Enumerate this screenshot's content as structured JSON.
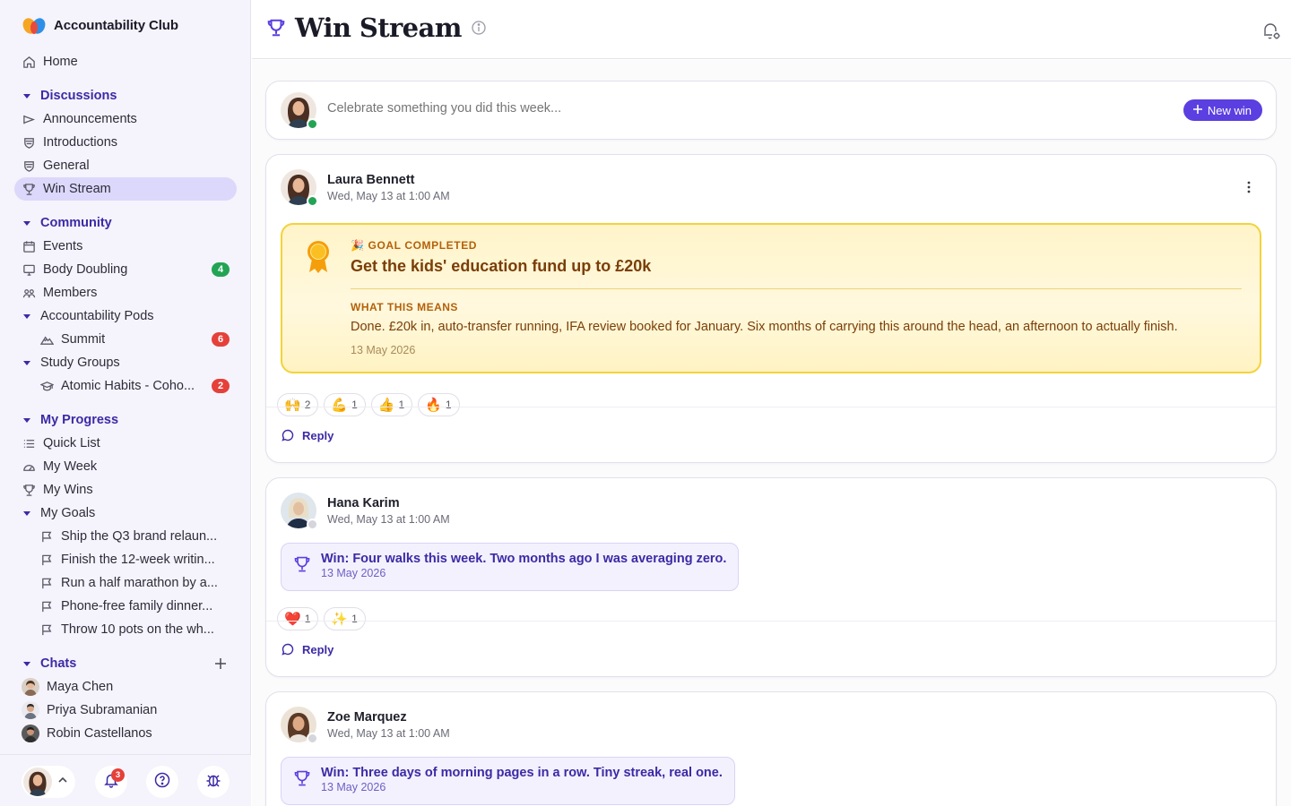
{
  "app": {
    "name": "Accountability Club"
  },
  "sidebar": {
    "home": "Home",
    "discussions": {
      "label": "Discussions",
      "items": [
        "Announcements",
        "Introductions",
        "General",
        "Win Stream"
      ]
    },
    "community": {
      "label": "Community",
      "events": "Events",
      "body_doubling": {
        "label": "Body Doubling",
        "badge": "4"
      },
      "members": "Members",
      "pods": {
        "label": "Accountability Pods",
        "items": [
          {
            "label": "Summit",
            "badge": "6"
          }
        ]
      },
      "study_groups": {
        "label": "Study Groups",
        "items": [
          {
            "label": "Atomic Habits - Coho...",
            "badge": "2"
          }
        ]
      }
    },
    "progress": {
      "label": "My Progress",
      "items": [
        "Quick List",
        "My Week",
        "My Wins"
      ],
      "goals": {
        "label": "My Goals",
        "items": [
          "Ship the Q3 brand relaun...",
          "Finish the 12-week writin...",
          "Run a half marathon by a...",
          "Phone-free family dinner...",
          "Throw 10 pots on the wh..."
        ]
      }
    },
    "chats": {
      "label": "Chats",
      "items": [
        "Maya Chen",
        "Priya Subramanian",
        "Robin Castellanos"
      ]
    },
    "footer": {
      "notification_count": "3"
    }
  },
  "header": {
    "title": "Win Stream"
  },
  "composer": {
    "placeholder": "Celebrate something you did this week...",
    "button": "New win"
  },
  "posts": [
    {
      "author": "Laura Bennett",
      "time": "Wed, May 13 at 1:00 AM",
      "goal": {
        "tag": "GOAL COMPLETED",
        "tag_emoji": "🎉",
        "title": "Get the kids' education fund up to £20k",
        "meaning_label": "WHAT THIS MEANS",
        "meaning": "Done. £20k in, auto-transfer running, IFA review booked for January. Six months of carrying this around the head, an afternoon to actually finish.",
        "date": "13 May 2026"
      },
      "reactions": [
        {
          "emoji": "🙌",
          "count": "2"
        },
        {
          "emoji": "💪",
          "count": "1"
        },
        {
          "emoji": "👍",
          "count": "1"
        },
        {
          "emoji": "🔥",
          "count": "1"
        }
      ],
      "reply": "Reply"
    },
    {
      "author": "Hana Karim",
      "time": "Wed, May 13 at 1:00 AM",
      "win_label": "Win:",
      "win_text": "Four walks this week. Two months ago I was averaging zero.",
      "date": "13 May 2026",
      "reactions": [
        {
          "emoji": "❤️",
          "count": "1"
        },
        {
          "emoji": "✨",
          "count": "1"
        }
      ],
      "reply": "Reply"
    },
    {
      "author": "Zoe Marquez",
      "time": "Wed, May 13 at 1:00 AM",
      "win_label": "Win:",
      "win_text": "Three days of morning pages in a row. Tiny streak, real one.",
      "date": "13 May 2026"
    }
  ],
  "colors": {
    "accent": "#5b3fe0",
    "section": "#3b2aa6",
    "goal_border": "#f2d33b",
    "online": "#22a454",
    "badge_red": "#e5403a",
    "badge_green": "#22a454"
  }
}
